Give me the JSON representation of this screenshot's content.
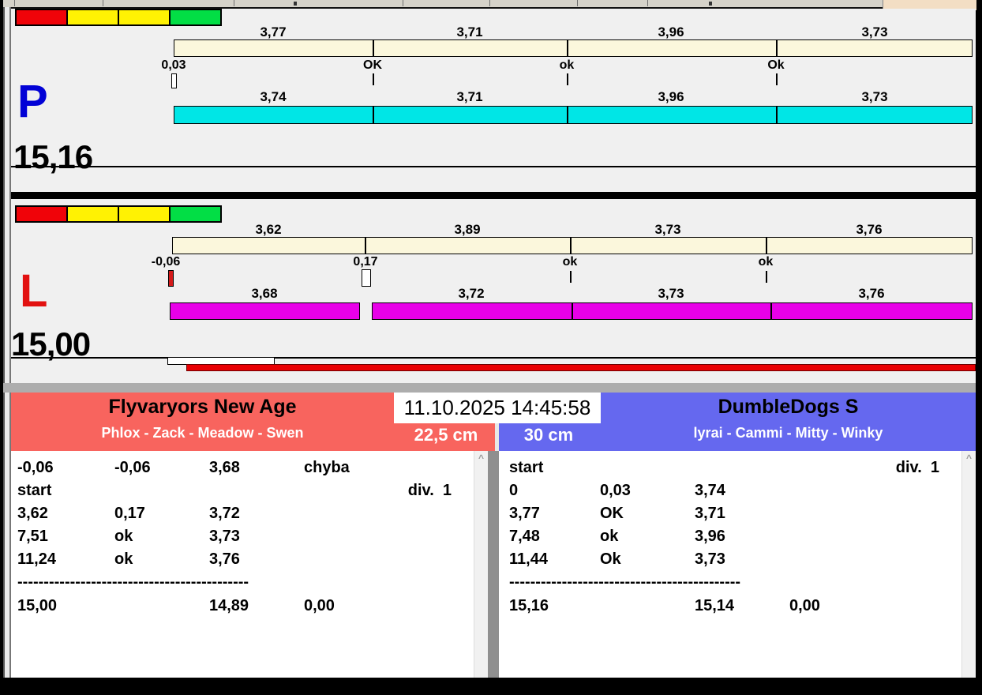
{
  "chips": {
    "colors": [
      "#F00309",
      "#FFF203",
      "#FFF203",
      "#02DE45"
    ]
  },
  "lanes": [
    {
      "letter": "P",
      "letter_color": "#0202D6",
      "total": "15,16",
      "split_labels_top": [
        "3,77",
        "3,71",
        "3,96",
        "3,73"
      ],
      "checkpoints": [
        "0,03",
        "OK",
        "ok",
        "Ok"
      ],
      "split_labels_bottom": [
        "3,74",
        "3,71",
        "3,96",
        "3,73"
      ],
      "bar_top_color": "#FBF7DC",
      "bar_bottom_color": "#00E6E6"
    },
    {
      "letter": "L",
      "letter_color": "#E21110",
      "total": "15,00",
      "split_labels_top": [
        "3,62",
        "3,89",
        "3,73",
        "3,76"
      ],
      "checkpoints": [
        "-0,06",
        "0,17",
        "ok",
        "ok"
      ],
      "split_labels_bottom": [
        "3,68",
        "3,72",
        "3,73",
        "3,76"
      ],
      "bar_top_color": "#FBF7DC",
      "bar_bottom_color": "#E800E8"
    }
  ],
  "progress": {
    "color": "#E90003"
  },
  "timestamp": "11.10.2025 14:45:58",
  "panels": [
    {
      "team": "Flyvaryors New Age",
      "dogs": "Phlox - Zack - Meadow - Swen",
      "jump_height": "22,5 cm",
      "accent": "#F8645E",
      "division_label": "div.  1",
      "rows": [
        [
          "-0,06",
          "-0,06",
          "3,68",
          "chyba"
        ],
        [
          "start",
          "",
          "",
          ""
        ],
        [
          "3,62",
          "0,17",
          "3,72",
          ""
        ],
        [
          "7,51",
          "ok",
          "3,73",
          ""
        ],
        [
          "11,24",
          "ok",
          "3,76",
          ""
        ]
      ],
      "separator": "--------------------------------------------",
      "totals": [
        "15,00",
        "14,89",
        "0,00"
      ]
    },
    {
      "team": "DumbleDogs S",
      "dogs": "lyrai - Cammi - Mitty - Winky",
      "jump_height": "30 cm",
      "accent": "#6568EF",
      "division_label": "div.  1",
      "rows": [
        [
          "start",
          "",
          "",
          ""
        ],
        [
          "0",
          "0,03",
          "3,74",
          ""
        ],
        [
          "3,77",
          "OK",
          "3,71",
          ""
        ],
        [
          "7,48",
          "ok",
          "3,96",
          ""
        ],
        [
          "11,44",
          "Ok",
          "3,73",
          ""
        ]
      ],
      "separator": "--------------------------------------------",
      "totals": [
        "15,16",
        "15,14",
        "0,00"
      ]
    }
  ]
}
